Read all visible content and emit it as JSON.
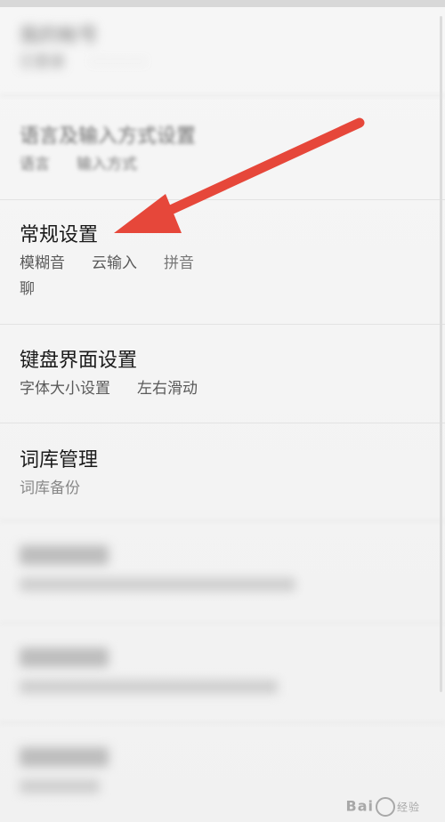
{
  "settings": {
    "items": [
      {
        "title": "我的帐号",
        "subs": [
          "已登录"
        ],
        "state": "blurred"
      },
      {
        "title": "语言及输入方式设置",
        "subs": [
          "语言",
          "输入方式"
        ],
        "state": "soft"
      },
      {
        "title": "常规设置",
        "subs": [
          "模糊音",
          "云输入",
          "拼音"
        ],
        "wrap": "聊",
        "state": "clear"
      },
      {
        "title": "键盘界面设置",
        "subs": [
          "字体大小设置",
          "左右滑动"
        ],
        "state": "clear"
      },
      {
        "title": "词库管理",
        "subs": [
          "词库备份"
        ],
        "state": "clear"
      },
      {
        "title": "",
        "subs": [],
        "state": "blurred"
      },
      {
        "title": "",
        "subs": [],
        "state": "blurred"
      },
      {
        "title": "",
        "subs": [],
        "state": "blurred"
      }
    ]
  },
  "annotation": {
    "arrow_color": "#e6473a"
  },
  "watermark": {
    "brand": "Bai",
    "brand_tail": "经验"
  }
}
